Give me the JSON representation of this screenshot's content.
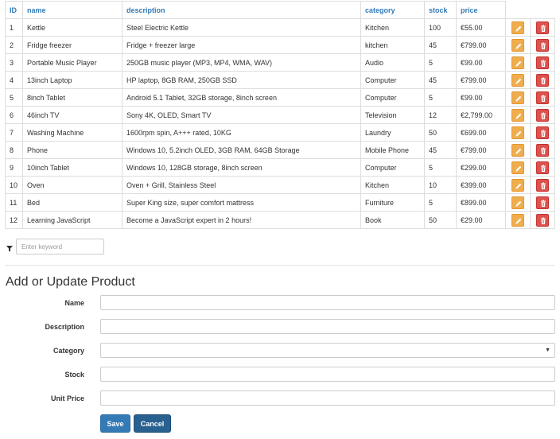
{
  "table": {
    "headers": [
      "ID",
      "name",
      "description",
      "category",
      "stock",
      "price"
    ],
    "rows": [
      {
        "id": "1",
        "name": "Kettle",
        "description": "Steel Electric Kettle",
        "category": "Kitchen",
        "stock": "100",
        "price": "€55.00"
      },
      {
        "id": "2",
        "name": "Fridge freezer",
        "description": "Fridge + freezer large",
        "category": "kitchen",
        "stock": "45",
        "price": "€799.00"
      },
      {
        "id": "3",
        "name": "Portable Music Player",
        "description": "250GB music player (MP3, MP4, WMA, WAV)",
        "category": "Audio",
        "stock": "5",
        "price": "€99.00"
      },
      {
        "id": "4",
        "name": "13inch Laptop",
        "description": "HP laptop, 8GB RAM, 250GB SSD",
        "category": "Computer",
        "stock": "45",
        "price": "€799.00"
      },
      {
        "id": "5",
        "name": "8inch Tablet",
        "description": "Android 5.1 Tablet, 32GB storage, 8inch screen",
        "category": "Computer",
        "stock": "5",
        "price": "€99.00"
      },
      {
        "id": "6",
        "name": "46inch TV",
        "description": "Sony 4K, OLED, Smart TV",
        "category": "Television",
        "stock": "12",
        "price": "€2,799.00"
      },
      {
        "id": "7",
        "name": "Washing Machine",
        "description": "1600rpm spin, A+++ rated, 10KG",
        "category": "Laundry",
        "stock": "50",
        "price": "€699.00"
      },
      {
        "id": "8",
        "name": "Phone",
        "description": "Windows 10, 5.2inch OLED, 3GB RAM, 64GB Storage",
        "category": "Mobile Phone",
        "stock": "45",
        "price": "€799.00"
      },
      {
        "id": "9",
        "name": "10inch Tablet",
        "description": "Windows 10, 128GB storage, 8inch screen",
        "category": "Computer",
        "stock": "5",
        "price": "€299.00"
      },
      {
        "id": "10",
        "name": "Oven",
        "description": "Oven + Grill, Stainless Steel",
        "category": "Kitchen",
        "stock": "10",
        "price": "€399.00"
      },
      {
        "id": "11",
        "name": "Bed",
        "description": "Super King size, super comfort mattress",
        "category": "Furniture",
        "stock": "5",
        "price": "€899.00"
      },
      {
        "id": "12",
        "name": "Learning JavaScript",
        "description": "Become a JavaScript expert in 2 hours!",
        "category": "Book",
        "stock": "50",
        "price": "€29.00"
      }
    ],
    "edit_icon": "pencil-icon",
    "delete_icon": "trash-icon"
  },
  "filter": {
    "icon": "filter-icon",
    "placeholder": "Enter keyword",
    "value": ""
  },
  "form": {
    "title": "Add or Update Product",
    "name_label": "Name",
    "description_label": "Description",
    "category_label": "Category",
    "stock_label": "Stock",
    "unit_price_label": "Unit Price",
    "name_value": "",
    "description_value": "",
    "category_value": "",
    "stock_value": "",
    "unit_price_value": "",
    "save_label": "Save",
    "cancel_label": "Cancel"
  },
  "colors": {
    "header_link": "#337ab7",
    "edit_button": "#f0ad4e",
    "delete_button": "#d9534f",
    "save_button": "#337ab7",
    "cancel_button": "#286090"
  }
}
